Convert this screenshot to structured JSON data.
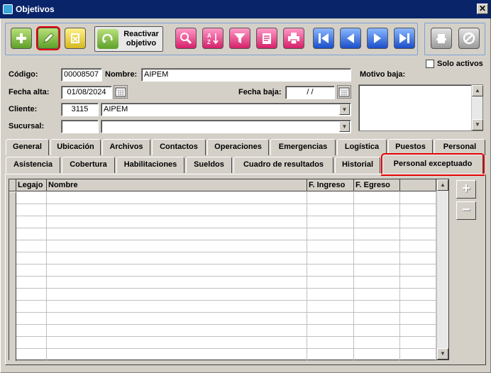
{
  "window": {
    "title": "Objetivos"
  },
  "toolbar": {
    "reactivar_label_1": "Reactivar",
    "reactivar_label_2": "objetivo",
    "buttons": [
      "add-icon",
      "edit-icon",
      "delete-icon",
      "search-icon",
      "sort-az-icon",
      "filter-icon",
      "report-icon",
      "print-icon",
      "first-icon",
      "prev-icon",
      "next-icon",
      "last-icon",
      "disabled-action-icon",
      "cancel-icon"
    ]
  },
  "solo_activos": {
    "label": "Solo activos",
    "checked": false
  },
  "form": {
    "codigo_label": "Código:",
    "codigo_value": "00008507",
    "nombre_label": "Nombre:",
    "nombre_value": "AIPEM",
    "motivo_baja_label": "Motivo baja:",
    "fecha_alta_label": "Fecha alta:",
    "fecha_alta_value": "01/08/2024",
    "fecha_baja_label": "Fecha baja:",
    "fecha_baja_value": " /  / ",
    "cliente_label": "Cliente:",
    "cliente_code": "3115",
    "cliente_name": "AIPEM",
    "sucursal_label": "Sucursal:",
    "sucursal_code": "",
    "sucursal_name": ""
  },
  "tabs_row1": [
    "General",
    "Ubicación",
    "Archivos",
    "Contactos",
    "Operaciones",
    "Emergencias",
    "Logística",
    "Puestos",
    "Personal"
  ],
  "tabs_row2": [
    "Asistencia",
    "Cobertura",
    "Habilitaciones",
    "Sueldos",
    "Cuadro de resultados",
    "Historial",
    "Personal exceptuado"
  ],
  "active_tab": "Personal exceptuado",
  "grid": {
    "columns": [
      "Legajo",
      "Nombre",
      "F. Ingreso",
      "F. Egreso",
      ""
    ],
    "row_count": 14
  },
  "colors": {
    "titlebar": "#0a246a",
    "highlight": "#e00000",
    "window_bg": "#d4d0c8"
  }
}
